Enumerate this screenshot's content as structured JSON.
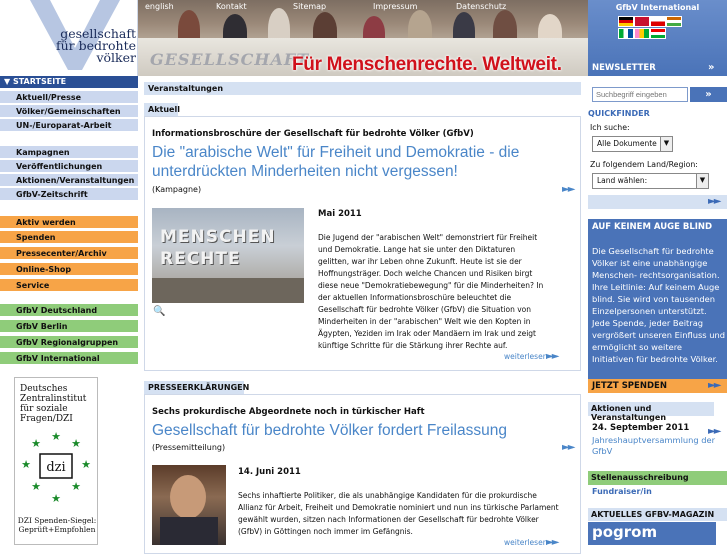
{
  "header": {
    "logo_lines": [
      "gesellschaft",
      "für bedrohte",
      "völker"
    ],
    "slogan": "Für Menschenrechte. Weltweit.",
    "banner_watermark": "GESELLSCHAFT",
    "topnav": [
      "english",
      "Kontakt",
      "Sitemap",
      "Impressum",
      "Datenschutz"
    ],
    "international": "GfbV International",
    "newsletter": "NEWSLETTER"
  },
  "nav": {
    "head": "STARTSEITE",
    "groups": [
      {
        "color": "blue",
        "items": [
          "Aktuell/Presse",
          "Völker/Gemeinschaften",
          "UN-/Europarat-Arbeit"
        ]
      },
      {
        "color": "blue",
        "items": [
          "Kampagnen",
          "Veröffentlichungen",
          "Aktionen/Veranstaltungen",
          "GfbV-Zeitschrift"
        ]
      },
      {
        "color": "orange",
        "items": [
          "Aktiv werden",
          "Spenden",
          "Pressecenter/Archiv",
          "Online-Shop",
          "Service"
        ]
      },
      {
        "color": "green",
        "items": [
          "GfbV Deutschland",
          "GfbV Berlin",
          "GfbV Regionalgruppen",
          "GfbV International"
        ]
      }
    ]
  },
  "dzi": {
    "lines": [
      "Deutsches",
      "Zentralinstitut",
      "für soziale",
      "Fragen/DZI"
    ],
    "badge": "dzi",
    "footer": "DZI Spenden-Siegel: Geprüft+Empfohlen"
  },
  "main": {
    "veranstaltungen": "Veranstaltungen",
    "aktuell": "Aktuell",
    "article1": {
      "kicker": "Informationsbroschüre der Gesellschaft für bedrohte Völker (GfbV)",
      "title": "Die \"arabische Welt\" für Freiheit und Demokratie - die unterdrückten Minderheiten nicht vergessen!",
      "sub": "(Kampagne)",
      "date": "Mai 2011",
      "body": "Die Jugend der \"arabischen Welt\" demonstriert für Freiheit und Demokratie. Lange hat sie unter den Diktaturen gelitten, war ihr Leben ohne Zukunft. Heute ist sie der Hoffnungsträger. Doch welche Chancen und Risiken birgt diese neue \"Demokratiebewegung\" für die Minderheiten? In der aktuellen Informationsbroschüre beleuchtet die Gesellschaft für bedrohte Völker (GfbV) die Situation von Minderheiten in der \"arabischen\" Welt wie den Kopten in Ägypten, Yeziden im Irak oder Mandäern im Irak und zeigt künftige Schritte für die Stärkung ihrer Rechte auf.",
      "image_text": "MENSCHEN RECHTE",
      "more": "weiterlesen"
    },
    "presse_head": "PRESSEERKLÄRUNGEN",
    "article2": {
      "kicker": "Sechs prokurdische Abgeordnete noch in türkischer Haft",
      "title": "Gesellschaft für bedrohte Völker fordert Freilassung",
      "sub": "(Pressemitteilung)",
      "date": "14. Juni 2011",
      "body": "Sechs inhaftierte Politiker, die als unabhängige Kandidaten für die prokurdische Allianz für Arbeit, Freiheit und Demokratie nominiert und nun ins türkische Parlament gewählt wurden, sitzen nach Informationen der Gesellschaft für bedrohte Völker (GfbV) in Göttingen noch immer im Gefängnis.",
      "more": "weiterlesen"
    }
  },
  "right": {
    "search_placeholder": "Suchbegriff eingeben",
    "quickfinder": "QUICKFINDER",
    "suche_label": "Ich suche:",
    "suche_value": "Alle Dokumente",
    "land_label": "Zu folgendem Land/Region:",
    "land_value": "Land wählen:",
    "blind_title": "AUF KEINEM AUGE BLIND",
    "blind_body": "Die Gesellschaft für bedrohte Völker ist eine unabhängige Menschen- rechtsorganisation. Ihre Leitlinie: Auf keinem Auge blind. Sie wird von tausenden Einzelpersonen unterstützt. Jede Spende, jeder Beitrag vergrößert unseren Einfluss und ermöglicht so weitere Initiativen für bedrohte Völker.",
    "spenden": "JETZT SPENDEN",
    "aktionen": "Aktionen und Veranstaltungen",
    "event_date": "24. September 2011",
    "event_desc": "Jahreshauptversammlung der GfbV",
    "stellen": "Stellenausschreibung",
    "fundraiser": "Fundraiser/in",
    "magazin": "AKTUELLES GFBV-MAGAZIN",
    "pogrom": "pogrom"
  },
  "colors": {
    "brand_blue": "#4a73b8",
    "link_blue": "#4a86c8",
    "slogan_red": "#d0111b",
    "nav_blue": "#cbd7ee",
    "nav_orange": "#f7a447",
    "nav_green": "#8fcc7a"
  }
}
